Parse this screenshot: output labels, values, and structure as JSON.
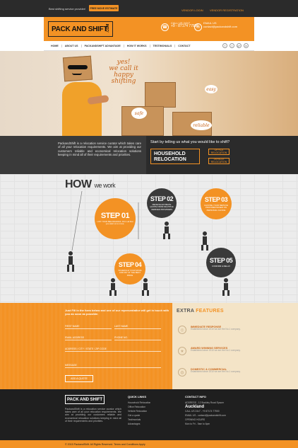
{
  "topbar": {
    "tagline": "Best shifting service provider!",
    "free_quote": "FREE MOVE ESTIMATE",
    "vendor_login": "VENDOR LOGIN",
    "vendor_registration": "VENDOR REGISTRATION"
  },
  "header": {
    "logo": "PACK AND SHIFT",
    "logo_com": ".COM",
    "call_label": "CALL US 24X7",
    "phone": "+9 - 87174 77899",
    "email_label": "EMAIL US",
    "email": "contact@packandshift.com"
  },
  "nav": [
    "HOME",
    "ABOUT US",
    "PACKANDSHIFT ADVANTAGE",
    "HOW IT WORKS",
    "TESTIMONIALS",
    "CONTACT"
  ],
  "social": [
    "f",
    "t",
    "g+",
    "in"
  ],
  "hero": {
    "speech": [
      "yes!",
      "we call it",
      "happy",
      "shifting"
    ],
    "badge_easy": "easy",
    "badge_safe": "safe",
    "badge_reliable": "reliable"
  },
  "service": {
    "about": "PackandShift is a relocation service curator which takes care of all your relocation requirements. We aim at providing our customers reliable and economical relocation solutions keeping in mind all of their requirements and priorities.",
    "question": "Start by telling us what you would like to shift?",
    "household": "HOUSEHOLD RELOCATION",
    "office": "OFFICE RELOCATION",
    "vehicle": "VEHICLE RELOCATION"
  },
  "how": {
    "title": "HOW",
    "title_sub": "we work",
    "steps": [
      {
        "label": "STEP 01",
        "desc": "LIST YOUR BELONGINGS. Fill in all that you want us to move."
      },
      {
        "label": "STEP 02",
        "desc": "RECEIVE ESTIMATE QUOTE FROM MULTIPLE VERIFIED PROVIDERS"
      },
      {
        "label": "STEP 03",
        "desc": "CHOOSE YOUR SERVICE PROVIDER BASED ON PERSONAL CHOICE"
      },
      {
        "label": "STEP 04",
        "desc": "SCHEDULE YOUR MOVE AND PAY AT THE BEST PRICE"
      },
      {
        "label": "STEP 05",
        "desc": "CONFIRM & RELAX"
      }
    ]
  },
  "form": {
    "heading": "Just Fill in the form below and one of our representative will get in touch with you as soon as possible.",
    "fields": [
      "FIRST NAME",
      "LAST NAME",
      "EMAIL ADDRESS",
      "PHONE NO.",
      "ADDRESS / CITY / STATE / ZIP CODE",
      "MESSAGE"
    ],
    "submit": "ADD A QUOTE"
  },
  "features": {
    "title_a": "EXTRA",
    "title_b": "FEATURES",
    "items": [
      {
        "title": "IMMEDIATE RESPONSE",
        "desc": "Established since 2010 we are the No.1 company."
      },
      {
        "title": "AWARD WINNING SERVICES",
        "desc": "Established since 2010 we are the No.1 company."
      },
      {
        "title": "DOMESTIC & COMMERCIAL",
        "desc": "Established since 2010 we are the No.1 company."
      }
    ]
  },
  "footer": {
    "logo": "PACK AND SHIFT",
    "about": "PackandShift is a relocation service curator which takes care of all your relocation requirements. We aim at providing our customers reliable and economical relocation solutions keeping in mind all of their requirements and priorities.",
    "quick_title": "QUICK LINKS",
    "quick": [
      "Household Relocation",
      "Office Relocation",
      "Vehicle Relocation",
      "Get a quote",
      "Testimonials",
      "Advantages"
    ],
    "contact_title": "CONTACT INFO",
    "address": "ADDRESS - 12 Buckley Road Epsom",
    "city": "Auckland",
    "call": "CALL US 24x7 - +9 87174 77900",
    "email": "EMAIL US - contact@packandshift.com",
    "hours_title": "OPENING HOURS",
    "hours": "Mon to Fri - 9am to 6pm"
  },
  "copyright": "© 2015 PackandShift. All Rights Reserved. Terms and Conditions Apply"
}
